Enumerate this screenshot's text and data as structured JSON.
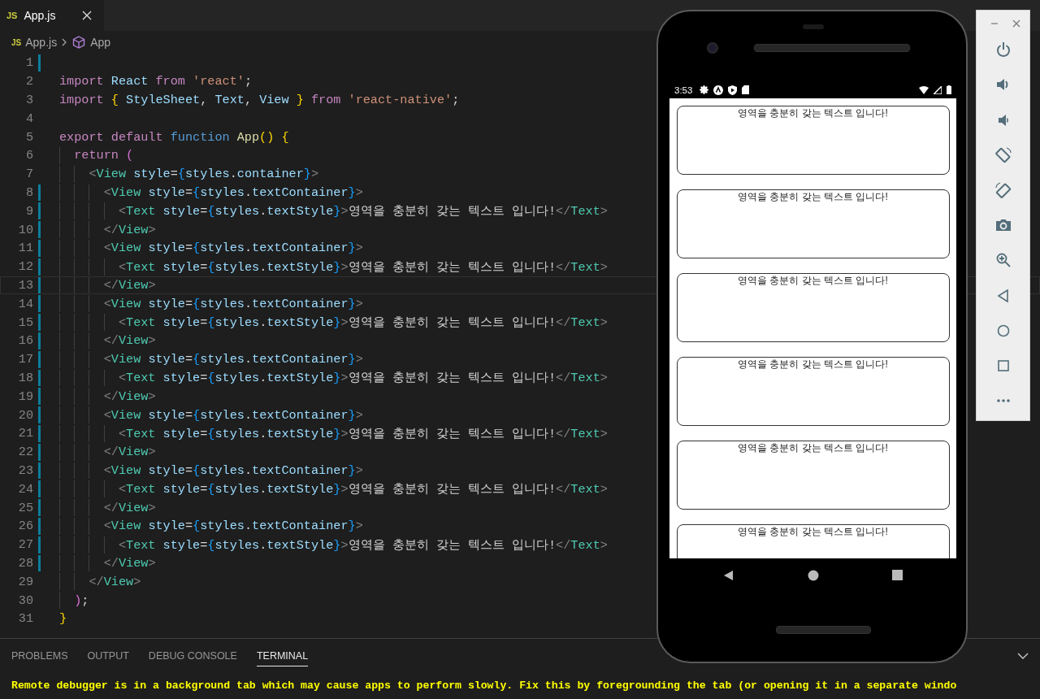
{
  "editor": {
    "tabs": [
      {
        "icon": "JS",
        "label": "App.js",
        "selected": true
      }
    ],
    "breadcrumb": {
      "file_icon": "JS",
      "file": "App.js",
      "symbol": "App"
    },
    "lines": [
      {
        "number": "1",
        "modified": true,
        "current": false
      },
      {
        "number": "2",
        "modified": false,
        "current": false,
        "tokens": [
          {
            "kind": "kw",
            "text": "import"
          },
          {
            "kind": "var",
            "text": " React"
          },
          {
            "kind": "kw",
            "text": " from"
          },
          {
            "kind": "str",
            "text": " 'react'"
          },
          {
            "kind": "tx",
            "text": ";"
          }
        ]
      },
      {
        "number": "3",
        "modified": false,
        "current": false,
        "tokens": [
          {
            "kind": "kw",
            "text": "import"
          },
          {
            "kind": "y",
            "text": " {"
          },
          {
            "kind": "var",
            "text": " StyleSheet"
          },
          {
            "kind": "tx",
            "text": ","
          },
          {
            "kind": "var",
            "text": " Text"
          },
          {
            "kind": "tx",
            "text": ","
          },
          {
            "kind": "var",
            "text": " View"
          },
          {
            "kind": "y",
            "text": " }"
          },
          {
            "kind": "kw",
            "text": " from"
          },
          {
            "kind": "str",
            "text": " 'react-native'"
          },
          {
            "kind": "tx",
            "text": ";"
          }
        ]
      },
      {
        "number": "4",
        "modified": false,
        "current": false
      },
      {
        "number": "5",
        "modified": false,
        "current": false,
        "tokens": [
          {
            "kind": "kw",
            "text": "export"
          },
          {
            "kind": "kw",
            "text": " default"
          },
          {
            "kind": "st",
            "text": " function"
          },
          {
            "kind": "fn",
            "text": " App"
          },
          {
            "kind": "y",
            "text": "()"
          },
          {
            "kind": "y",
            "text": " {"
          }
        ]
      },
      {
        "number": "6",
        "modified": false,
        "current": false,
        "tokens": [
          {
            "kind": "kw",
            "text": "  return"
          },
          {
            "kind": "p",
            "text": " ("
          }
        ]
      },
      {
        "number": "7",
        "modified": false,
        "current": false,
        "tokens": [
          {
            "kind": "pu",
            "text": "    <"
          },
          {
            "kind": "tag",
            "text": "View"
          },
          {
            "kind": "var",
            "text": " style"
          },
          {
            "kind": "tx",
            "text": "="
          },
          {
            "kind": "br",
            "text": "{"
          },
          {
            "kind": "var",
            "text": "styles"
          },
          {
            "kind": "tx",
            "text": "."
          },
          {
            "kind": "var",
            "text": "container"
          },
          {
            "kind": "br",
            "text": "}"
          },
          {
            "kind": "pu",
            "text": ">"
          }
        ]
      },
      {
        "number": "8",
        "modified": true,
        "current": false,
        "tokens": [
          {
            "kind": "pu",
            "text": "      <"
          },
          {
            "kind": "tag",
            "text": "View"
          },
          {
            "kind": "var",
            "text": " style"
          },
          {
            "kind": "tx",
            "text": "="
          },
          {
            "kind": "br",
            "text": "{"
          },
          {
            "kind": "var",
            "text": "styles"
          },
          {
            "kind": "tx",
            "text": "."
          },
          {
            "kind": "var",
            "text": "textContainer"
          },
          {
            "kind": "br",
            "text": "}"
          },
          {
            "kind": "pu",
            "text": ">"
          }
        ]
      },
      {
        "number": "9",
        "modified": true,
        "current": false,
        "tokens": [
          {
            "kind": "pu",
            "text": "        <"
          },
          {
            "kind": "tag",
            "text": "Text"
          },
          {
            "kind": "var",
            "text": " style"
          },
          {
            "kind": "tx",
            "text": "="
          },
          {
            "kind": "br",
            "text": "{"
          },
          {
            "kind": "var",
            "text": "styles"
          },
          {
            "kind": "tx",
            "text": "."
          },
          {
            "kind": "var",
            "text": "textStyle"
          },
          {
            "kind": "br",
            "text": "}"
          },
          {
            "kind": "pu",
            "text": ">"
          },
          {
            "kind": "tx",
            "text": "영역을 충분히 갖는 텍스트 입니다!"
          },
          {
            "kind": "pu",
            "text": "</"
          },
          {
            "kind": "tag",
            "text": "Text"
          },
          {
            "kind": "pu",
            "text": ">"
          }
        ]
      },
      {
        "number": "10",
        "modified": true,
        "current": false,
        "tokens": [
          {
            "kind": "pu",
            "text": "      </"
          },
          {
            "kind": "tag",
            "text": "View"
          },
          {
            "kind": "pu",
            "text": ">"
          }
        ]
      },
      {
        "number": "11",
        "modified": true,
        "current": false,
        "tokens": [
          {
            "kind": "pu",
            "text": "      <"
          },
          {
            "kind": "tag",
            "text": "View"
          },
          {
            "kind": "var",
            "text": " style"
          },
          {
            "kind": "tx",
            "text": "="
          },
          {
            "kind": "br",
            "text": "{"
          },
          {
            "kind": "var",
            "text": "styles"
          },
          {
            "kind": "tx",
            "text": "."
          },
          {
            "kind": "var",
            "text": "textContainer"
          },
          {
            "kind": "br",
            "text": "}"
          },
          {
            "kind": "pu",
            "text": ">"
          }
        ]
      },
      {
        "number": "12",
        "modified": true,
        "current": false,
        "tokens": [
          {
            "kind": "pu",
            "text": "        <"
          },
          {
            "kind": "tag",
            "text": "Text"
          },
          {
            "kind": "var",
            "text": " style"
          },
          {
            "kind": "tx",
            "text": "="
          },
          {
            "kind": "br",
            "text": "{"
          },
          {
            "kind": "var",
            "text": "styles"
          },
          {
            "kind": "tx",
            "text": "."
          },
          {
            "kind": "var",
            "text": "textStyle"
          },
          {
            "kind": "br",
            "text": "}"
          },
          {
            "kind": "pu",
            "text": ">"
          },
          {
            "kind": "tx",
            "text": "영역을 충분히 갖는 텍스트 입니다!"
          },
          {
            "kind": "pu",
            "text": "</"
          },
          {
            "kind": "tag",
            "text": "Text"
          },
          {
            "kind": "pu",
            "text": ">"
          }
        ]
      },
      {
        "number": "13",
        "modified": true,
        "current": true,
        "tokens": [
          {
            "kind": "pu",
            "text": "      </"
          },
          {
            "kind": "tag",
            "text": "View"
          },
          {
            "kind": "pu",
            "text": ">"
          }
        ]
      },
      {
        "number": "14",
        "modified": true,
        "current": false,
        "tokens": [
          {
            "kind": "pu",
            "text": "      <"
          },
          {
            "kind": "tag",
            "text": "View"
          },
          {
            "kind": "var",
            "text": " style"
          },
          {
            "kind": "tx",
            "text": "="
          },
          {
            "kind": "br",
            "text": "{"
          },
          {
            "kind": "var",
            "text": "styles"
          },
          {
            "kind": "tx",
            "text": "."
          },
          {
            "kind": "var",
            "text": "textContainer"
          },
          {
            "kind": "br",
            "text": "}"
          },
          {
            "kind": "pu",
            "text": ">"
          }
        ]
      },
      {
        "number": "15",
        "modified": true,
        "current": false,
        "tokens": [
          {
            "kind": "pu",
            "text": "        <"
          },
          {
            "kind": "tag",
            "text": "Text"
          },
          {
            "kind": "var",
            "text": " style"
          },
          {
            "kind": "tx",
            "text": "="
          },
          {
            "kind": "br",
            "text": "{"
          },
          {
            "kind": "var",
            "text": "styles"
          },
          {
            "kind": "tx",
            "text": "."
          },
          {
            "kind": "var",
            "text": "textStyle"
          },
          {
            "kind": "br",
            "text": "}"
          },
          {
            "kind": "pu",
            "text": ">"
          },
          {
            "kind": "tx",
            "text": "영역을 충분히 갖는 텍스트 입니다!"
          },
          {
            "kind": "pu",
            "text": "</"
          },
          {
            "kind": "tag",
            "text": "Text"
          },
          {
            "kind": "pu",
            "text": ">"
          }
        ]
      },
      {
        "number": "16",
        "modified": true,
        "current": false,
        "tokens": [
          {
            "kind": "pu",
            "text": "      </"
          },
          {
            "kind": "tag",
            "text": "View"
          },
          {
            "kind": "pu",
            "text": ">"
          }
        ]
      },
      {
        "number": "17",
        "modified": true,
        "current": false,
        "tokens": [
          {
            "kind": "pu",
            "text": "      <"
          },
          {
            "kind": "tag",
            "text": "View"
          },
          {
            "kind": "var",
            "text": " style"
          },
          {
            "kind": "tx",
            "text": "="
          },
          {
            "kind": "br",
            "text": "{"
          },
          {
            "kind": "var",
            "text": "styles"
          },
          {
            "kind": "tx",
            "text": "."
          },
          {
            "kind": "var",
            "text": "textContainer"
          },
          {
            "kind": "br",
            "text": "}"
          },
          {
            "kind": "pu",
            "text": ">"
          }
        ]
      },
      {
        "number": "18",
        "modified": true,
        "current": false,
        "tokens": [
          {
            "kind": "pu",
            "text": "        <"
          },
          {
            "kind": "tag",
            "text": "Text"
          },
          {
            "kind": "var",
            "text": " style"
          },
          {
            "kind": "tx",
            "text": "="
          },
          {
            "kind": "br",
            "text": "{"
          },
          {
            "kind": "var",
            "text": "styles"
          },
          {
            "kind": "tx",
            "text": "."
          },
          {
            "kind": "var",
            "text": "textStyle"
          },
          {
            "kind": "br",
            "text": "}"
          },
          {
            "kind": "pu",
            "text": ">"
          },
          {
            "kind": "tx",
            "text": "영역을 충분히 갖는 텍스트 입니다!"
          },
          {
            "kind": "pu",
            "text": "</"
          },
          {
            "kind": "tag",
            "text": "Text"
          },
          {
            "kind": "pu",
            "text": ">"
          }
        ]
      },
      {
        "number": "19",
        "modified": true,
        "current": false,
        "tokens": [
          {
            "kind": "pu",
            "text": "      </"
          },
          {
            "kind": "tag",
            "text": "View"
          },
          {
            "kind": "pu",
            "text": ">"
          }
        ]
      },
      {
        "number": "20",
        "modified": true,
        "current": false,
        "tokens": [
          {
            "kind": "pu",
            "text": "      <"
          },
          {
            "kind": "tag",
            "text": "View"
          },
          {
            "kind": "var",
            "text": " style"
          },
          {
            "kind": "tx",
            "text": "="
          },
          {
            "kind": "br",
            "text": "{"
          },
          {
            "kind": "var",
            "text": "styles"
          },
          {
            "kind": "tx",
            "text": "."
          },
          {
            "kind": "var",
            "text": "textContainer"
          },
          {
            "kind": "br",
            "text": "}"
          },
          {
            "kind": "pu",
            "text": ">"
          }
        ]
      },
      {
        "number": "21",
        "modified": true,
        "current": false,
        "tokens": [
          {
            "kind": "pu",
            "text": "        <"
          },
          {
            "kind": "tag",
            "text": "Text"
          },
          {
            "kind": "var",
            "text": " style"
          },
          {
            "kind": "tx",
            "text": "="
          },
          {
            "kind": "br",
            "text": "{"
          },
          {
            "kind": "var",
            "text": "styles"
          },
          {
            "kind": "tx",
            "text": "."
          },
          {
            "kind": "var",
            "text": "textStyle"
          },
          {
            "kind": "br",
            "text": "}"
          },
          {
            "kind": "pu",
            "text": ">"
          },
          {
            "kind": "tx",
            "text": "영역을 충분히 갖는 텍스트 입니다!"
          },
          {
            "kind": "pu",
            "text": "</"
          },
          {
            "kind": "tag",
            "text": "Text"
          },
          {
            "kind": "pu",
            "text": ">"
          }
        ]
      },
      {
        "number": "22",
        "modified": true,
        "current": false,
        "tokens": [
          {
            "kind": "pu",
            "text": "      </"
          },
          {
            "kind": "tag",
            "text": "View"
          },
          {
            "kind": "pu",
            "text": ">"
          }
        ]
      },
      {
        "number": "23",
        "modified": true,
        "current": false,
        "tokens": [
          {
            "kind": "pu",
            "text": "      <"
          },
          {
            "kind": "tag",
            "text": "View"
          },
          {
            "kind": "var",
            "text": " style"
          },
          {
            "kind": "tx",
            "text": "="
          },
          {
            "kind": "br",
            "text": "{"
          },
          {
            "kind": "var",
            "text": "styles"
          },
          {
            "kind": "tx",
            "text": "."
          },
          {
            "kind": "var",
            "text": "textContainer"
          },
          {
            "kind": "br",
            "text": "}"
          },
          {
            "kind": "pu",
            "text": ">"
          }
        ]
      },
      {
        "number": "24",
        "modified": true,
        "current": false,
        "tokens": [
          {
            "kind": "pu",
            "text": "        <"
          },
          {
            "kind": "tag",
            "text": "Text"
          },
          {
            "kind": "var",
            "text": " style"
          },
          {
            "kind": "tx",
            "text": "="
          },
          {
            "kind": "br",
            "text": "{"
          },
          {
            "kind": "var",
            "text": "styles"
          },
          {
            "kind": "tx",
            "text": "."
          },
          {
            "kind": "var",
            "text": "textStyle"
          },
          {
            "kind": "br",
            "text": "}"
          },
          {
            "kind": "pu",
            "text": ">"
          },
          {
            "kind": "tx",
            "text": "영역을 충분히 갖는 텍스트 입니다!"
          },
          {
            "kind": "pu",
            "text": "</"
          },
          {
            "kind": "tag",
            "text": "Text"
          },
          {
            "kind": "pu",
            "text": ">"
          }
        ]
      },
      {
        "number": "25",
        "modified": true,
        "current": false,
        "tokens": [
          {
            "kind": "pu",
            "text": "      </"
          },
          {
            "kind": "tag",
            "text": "View"
          },
          {
            "kind": "pu",
            "text": ">"
          }
        ]
      },
      {
        "number": "26",
        "modified": true,
        "current": false,
        "tokens": [
          {
            "kind": "pu",
            "text": "      <"
          },
          {
            "kind": "tag",
            "text": "View"
          },
          {
            "kind": "var",
            "text": " style"
          },
          {
            "kind": "tx",
            "text": "="
          },
          {
            "kind": "br",
            "text": "{"
          },
          {
            "kind": "var",
            "text": "styles"
          },
          {
            "kind": "tx",
            "text": "."
          },
          {
            "kind": "var",
            "text": "textContainer"
          },
          {
            "kind": "br",
            "text": "}"
          },
          {
            "kind": "pu",
            "text": ">"
          }
        ]
      },
      {
        "number": "27",
        "modified": true,
        "current": false,
        "tokens": [
          {
            "kind": "pu",
            "text": "        <"
          },
          {
            "kind": "tag",
            "text": "Text"
          },
          {
            "kind": "var",
            "text": " style"
          },
          {
            "kind": "tx",
            "text": "="
          },
          {
            "kind": "br",
            "text": "{"
          },
          {
            "kind": "var",
            "text": "styles"
          },
          {
            "kind": "tx",
            "text": "."
          },
          {
            "kind": "var",
            "text": "textStyle"
          },
          {
            "kind": "br",
            "text": "}"
          },
          {
            "kind": "pu",
            "text": ">"
          },
          {
            "kind": "tx",
            "text": "영역을 충분히 갖는 텍스트 입니다!"
          },
          {
            "kind": "pu",
            "text": "</"
          },
          {
            "kind": "tag",
            "text": "Text"
          },
          {
            "kind": "pu",
            "text": ">"
          }
        ]
      },
      {
        "number": "28",
        "modified": true,
        "current": false,
        "tokens": [
          {
            "kind": "pu",
            "text": "      </"
          },
          {
            "kind": "tag",
            "text": "View"
          },
          {
            "kind": "pu",
            "text": ">"
          }
        ]
      },
      {
        "number": "29",
        "modified": false,
        "current": false,
        "tokens": [
          {
            "kind": "pu",
            "text": "    </"
          },
          {
            "kind": "tag",
            "text": "View"
          },
          {
            "kind": "pu",
            "text": ">"
          }
        ]
      },
      {
        "number": "30",
        "modified": false,
        "current": false,
        "tokens": [
          {
            "kind": "p",
            "text": "  )"
          },
          {
            "kind": "tx",
            "text": ";"
          }
        ]
      },
      {
        "number": "31",
        "modified": false,
        "current": false,
        "tokens": [
          {
            "kind": "y",
            "text": "}"
          }
        ]
      }
    ]
  },
  "panel": {
    "tabs": [
      {
        "label": "PROBLEMS",
        "selected": false
      },
      {
        "label": "OUTPUT",
        "selected": false
      },
      {
        "label": "DEBUG CONSOLE",
        "selected": false
      },
      {
        "label": "TERMINAL",
        "selected": true
      }
    ],
    "terminal_lines": [
      "Remote debugger is in a background tab which may cause apps to perform slowly. Fix this by foregrounding the tab (or opening it in a separate windo"
    ]
  },
  "phone": {
    "status_bar": {
      "time": "3:53"
    },
    "cards": [
      {
        "text": "영역을 충분히 갖는 텍스트 입니다!"
      },
      {
        "text": "영역을 충분히 갖는 텍스트 입니다!"
      },
      {
        "text": "영역을 충분히 갖는 텍스트 입니다!"
      },
      {
        "text": "영역을 충분히 갖는 텍스트 입니다!"
      },
      {
        "text": "영역을 충분히 갖는 텍스트 입니다!"
      },
      {
        "text": "영역을 충분히 갖는 텍스트 입니다!"
      }
    ]
  }
}
